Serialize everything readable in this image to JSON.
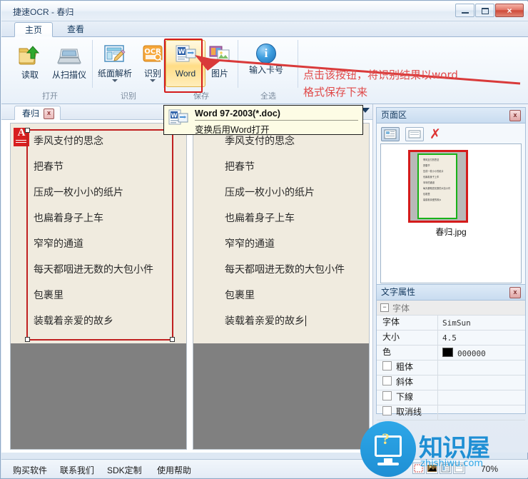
{
  "window": {
    "title": "捷速OCR - 春归",
    "buttons": {
      "minimize": "最小化",
      "maximize": "最大化",
      "close": "×"
    }
  },
  "ribbon": {
    "tabs": [
      {
        "label": "主页",
        "active": true
      },
      {
        "label": "查看",
        "active": false
      }
    ],
    "groups": [
      {
        "label": "打开",
        "buttons": [
          {
            "label": "读取",
            "icon": "open-folder-icon",
            "dropdown": false,
            "selected": false
          },
          {
            "label": "从扫描仪",
            "icon": "scanner-icon",
            "dropdown": false,
            "selected": false
          }
        ]
      },
      {
        "label": "识别",
        "buttons": [
          {
            "label": "纸面解析",
            "icon": "page-analysis-icon",
            "dropdown": true,
            "selected": false
          },
          {
            "label": "识别",
            "icon": "ocr-icon",
            "dropdown": true,
            "selected": false
          }
        ]
      },
      {
        "label": "保存",
        "buttons": [
          {
            "label": "Word",
            "icon": "word-icon",
            "dropdown": false,
            "selected": true
          },
          {
            "label": "图片",
            "icon": "image-icon",
            "dropdown": false,
            "selected": false
          }
        ]
      },
      {
        "label": "全选",
        "buttons": [
          {
            "label": "输入卡号",
            "icon": "info-icon",
            "dropdown": false,
            "selected": false
          }
        ]
      }
    ]
  },
  "annotation": {
    "line1": "点击该按钮，将识别结果以word",
    "line2": "格式保存下来",
    "color": "#e04a4a"
  },
  "tooltip": {
    "title": "Word 97-2003(*.doc)",
    "subtitle": "变换后用Word打开",
    "icon": "word-doc-icon"
  },
  "doc_tabs": {
    "items": [
      {
        "label": "春归",
        "close": "x"
      }
    ],
    "overflow_icon": "chevron-down-icon"
  },
  "document": {
    "source_lines": [
      "季风支付的思念",
      "把春节",
      "压成一枚小小的纸片",
      "也扁着身子上车",
      "窄窄的通道",
      "每天都咽进无数的大包小件",
      "包裹里",
      "装载着亲爱的故乡"
    ],
    "result_lines": [
      "季风支付的思念",
      "把春节",
      "压成一枚小小的纸片",
      "也扁着身子上车",
      "窄窄的通道",
      "每天都咽进无数的大包小件",
      "包裹里",
      "装载着亲爱的故乡"
    ],
    "zone_badge": "A"
  },
  "page_panel": {
    "title": "页面区",
    "close": "x",
    "tools": [
      {
        "name": "thumbnail-view-button",
        "pressed": true
      },
      {
        "name": "single-page-view-button",
        "pressed": false
      },
      {
        "name": "delete-page-button",
        "glyph": "✗"
      }
    ],
    "thumbnail": {
      "caption": "春归.jpg",
      "lines": [
        "季风支付的思念",
        "把春节",
        "压成一枚小小的纸片",
        "也扁着身子上车",
        "窄窄的通道",
        "每天都咽进无数的大包小件",
        "包裹里",
        "装载着亲爱的故乡"
      ],
      "outer_border_color": "#d41b1b",
      "inner_border_color": "#19b219"
    }
  },
  "text_properties": {
    "title": "文字属性",
    "close": "x",
    "group_label": "字体",
    "rows": [
      {
        "key": "字体",
        "value": "SimSun"
      },
      {
        "key": "大小",
        "value": "4.5"
      },
      {
        "key": "色",
        "value": "000000",
        "swatch": "#000000"
      }
    ],
    "checkboxes": [
      {
        "label": "粗体",
        "checked": false
      },
      {
        "label": "斜体",
        "checked": false
      },
      {
        "label": "下線",
        "checked": false
      },
      {
        "label": "取消线",
        "checked": false
      }
    ]
  },
  "statusbar": {
    "links": [
      "购买软件",
      "联系我们",
      "SDK定制",
      "使用帮助"
    ],
    "view_buttons": [
      "select-view-icon",
      "image-view-icon",
      "text-view-icon",
      "blank-view-icon"
    ],
    "zoom": "70%"
  },
  "watermark": {
    "title": "知识屋",
    "url": "zhishiwu.com"
  }
}
